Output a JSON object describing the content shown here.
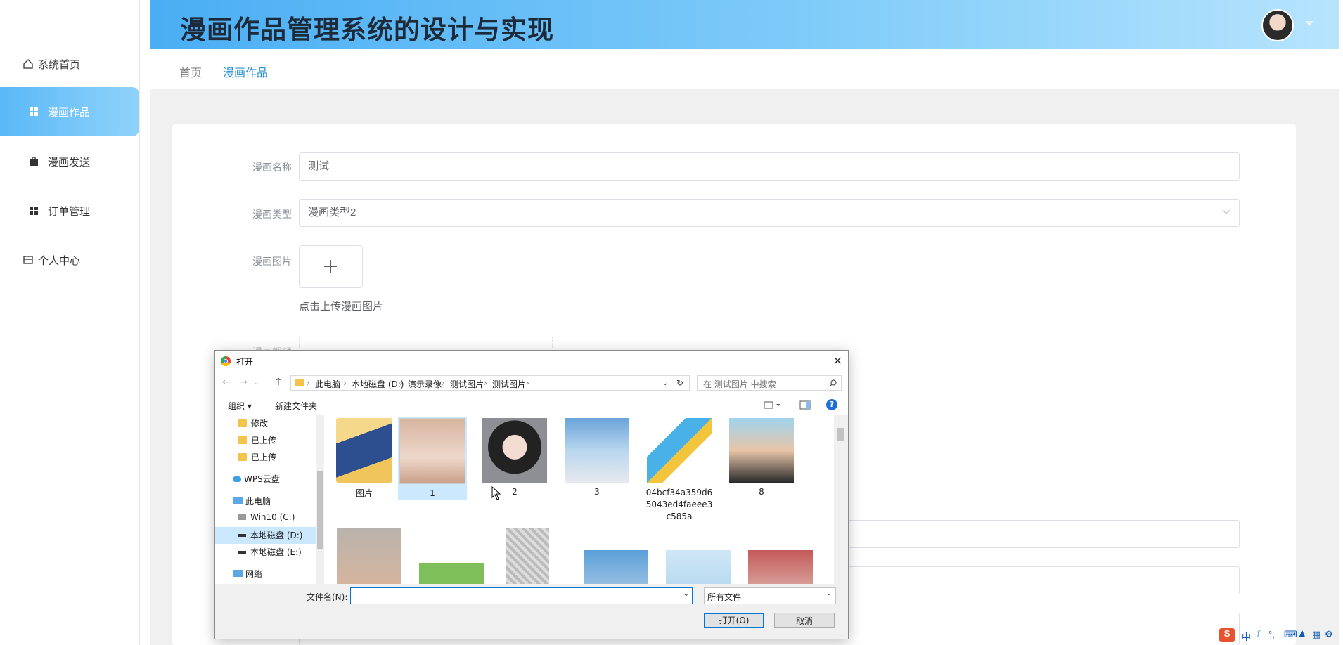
{
  "app": {
    "title": "漫画作品管理系统的设计与实现"
  },
  "sidebar": {
    "items": [
      {
        "label": "系统首页",
        "icon": "home-icon"
      },
      {
        "label": "漫画作品",
        "icon": "grid-icon",
        "active": true
      },
      {
        "label": "漫画发送",
        "icon": "briefcase-icon"
      },
      {
        "label": "订单管理",
        "icon": "grid-icon"
      },
      {
        "label": "个人中心",
        "icon": "id-card-icon"
      }
    ]
  },
  "breadcrumb": {
    "home": "首页",
    "current": "漫画作品"
  },
  "form": {
    "name_label": "漫画名称",
    "name_value": "测试",
    "type_label": "漫画类型",
    "type_value": "漫画类型2",
    "image_label": "漫画图片",
    "upload_hint": "点击上传漫画图片",
    "video_label": "漫画视频"
  },
  "dialog": {
    "title": "打开",
    "path": [
      "此电脑",
      "本地磁盘 (D:)",
      "演示录像",
      "测试图片",
      "测试图片"
    ],
    "search_placeholder": "在 测试图片 中搜索",
    "organize": "组织 ▾",
    "new_folder": "新建文件夹",
    "tree": [
      {
        "label": "修改",
        "type": "folder"
      },
      {
        "label": "已上传",
        "type": "folder"
      },
      {
        "label": "已上传",
        "type": "folder"
      },
      {
        "label": "WPS云盘",
        "type": "cloud"
      },
      {
        "label": "此电脑",
        "type": "pc"
      },
      {
        "label": "Win10 (C:)",
        "type": "drive"
      },
      {
        "label": "本地磁盘 (D:)",
        "type": "drive",
        "selected": true
      },
      {
        "label": "本地磁盘 (E:)",
        "type": "drive"
      },
      {
        "label": "网络",
        "type": "network"
      }
    ],
    "files": [
      {
        "label": "图片"
      },
      {
        "label": "1",
        "selected": true
      },
      {
        "label": "2"
      },
      {
        "label": "3"
      },
      {
        "label": "04bcf34a359d65043ed4faeee3c585a"
      },
      {
        "label": "8"
      }
    ],
    "filename_label": "文件名(N):",
    "filename_value": "",
    "filetype": "所有文件",
    "open_button": "打开(O)",
    "cancel_button": "取消"
  },
  "taskbar": {
    "ime": "中"
  },
  "colors": {
    "accent": "#5bb8f7",
    "header_start": "#4aaef4",
    "link": "#2b8fd6"
  }
}
